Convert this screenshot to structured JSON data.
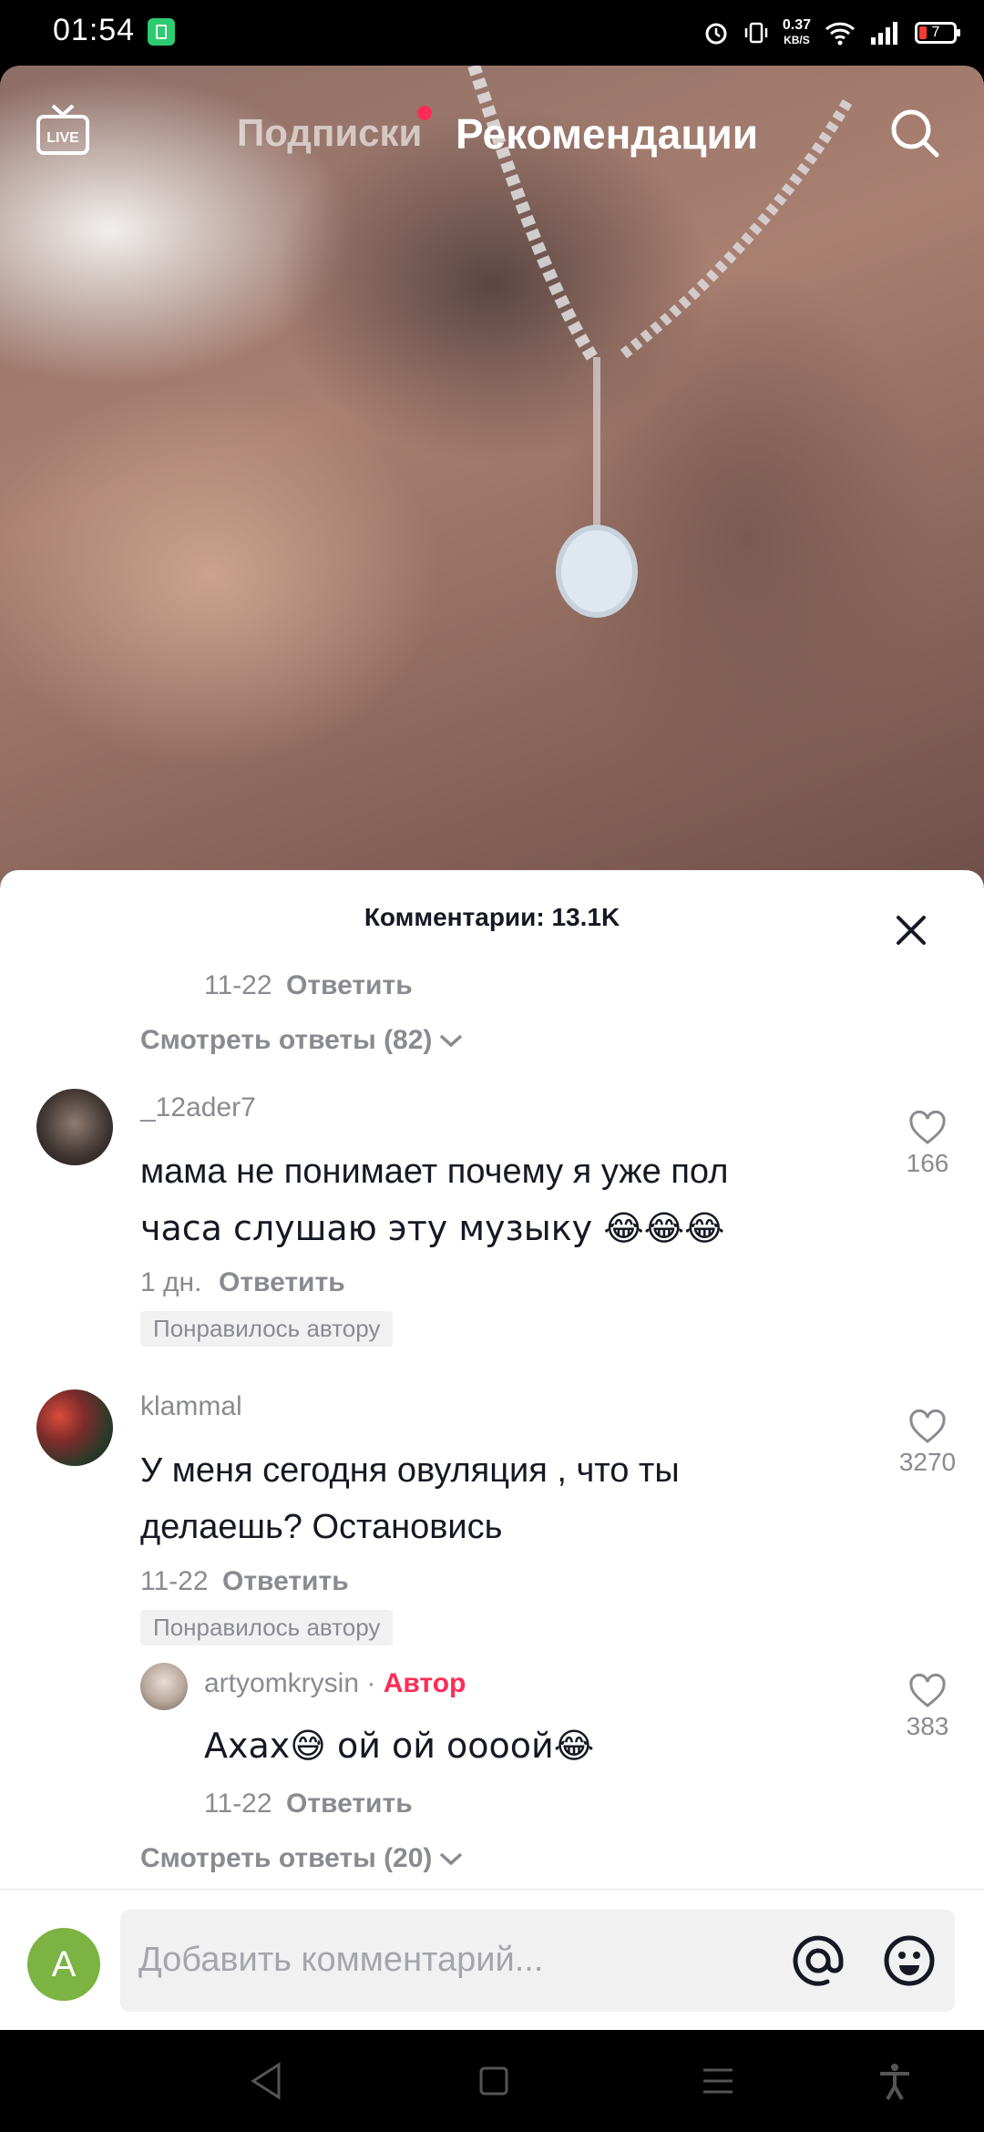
{
  "status_bar": {
    "time": "01:54",
    "net_speed": "0.37",
    "net_unit": "KB/S",
    "battery": "7"
  },
  "top_nav": {
    "live_label": "LIVE",
    "tab_following": "Подписки",
    "tab_for_you": "Рекомендации"
  },
  "comments": {
    "title": "Комментарии: 13.1K",
    "prev_reply": {
      "date": "11-22",
      "reply": "Ответить"
    },
    "view_replies_1": "Смотреть ответы (82)",
    "items": [
      {
        "username": "_12ader7",
        "text_line1": "мама не понимает почему я уже пол",
        "text_line2": "часа слушаю эту музыку 😂😂😂",
        "date": "1 дн.",
        "reply": "Ответить",
        "badge": "Понравилось автору",
        "likes": "166"
      },
      {
        "username": "klammal",
        "text_line1": "У меня сегодня овуляция , что ты",
        "text_line2": "делаешь? Остановись",
        "date": "11-22",
        "reply": "Ответить",
        "badge": "Понравилось автору",
        "likes": "3270"
      }
    ],
    "author_reply": {
      "username": "artyomkrysin",
      "separator": "·",
      "author_tag": "Автор",
      "text": "Ахах😅 ой ой оооой😂",
      "date": "11-22",
      "reply": "Ответить",
      "likes": "383"
    },
    "view_replies_2": "Смотреть ответы (20)"
  },
  "input": {
    "avatar_letter": "A",
    "placeholder": "Добавить комментарий..."
  },
  "colors": {
    "accent": "#fe2c55",
    "muted_text": "#8a8b91"
  }
}
